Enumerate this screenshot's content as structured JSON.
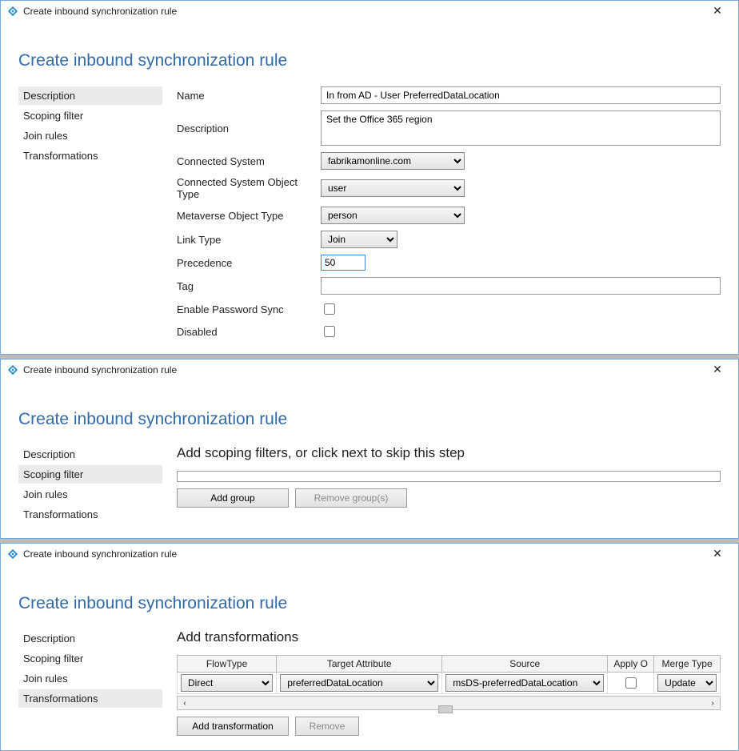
{
  "common": {
    "window_title": "Create inbound synchronization rule",
    "page_heading": "Create inbound synchronization rule",
    "close_glyph": "✕",
    "nav": {
      "description": "Description",
      "scoping": "Scoping filter",
      "join": "Join rules",
      "trans": "Transformations"
    }
  },
  "p1": {
    "labels": {
      "name": "Name",
      "description": "Description",
      "connected_system": "Connected System",
      "connected_obj_type": "Connected System Object Type",
      "mv_obj_type": "Metaverse Object Type",
      "link_type": "Link Type",
      "precedence": "Precedence",
      "tag": "Tag",
      "enable_pwd": "Enable Password Sync",
      "disabled": "Disabled"
    },
    "values": {
      "name": "In from AD - User PreferredDataLocation",
      "description": "Set the Office 365 region",
      "connected_system": "fabrikamonline.com",
      "connected_obj_type": "user",
      "mv_obj_type": "person",
      "link_type": "Join",
      "precedence": "50",
      "tag": ""
    }
  },
  "p2": {
    "heading": "Add scoping filters, or click next to skip this step",
    "add_group": "Add group",
    "remove_group": "Remove group(s)"
  },
  "p3": {
    "heading": "Add transformations",
    "cols": {
      "flowtype": "FlowType",
      "target": "Target Attribute",
      "source": "Source",
      "applyonce": "Apply Once",
      "applyonce_short": "Apply O",
      "merge": "Merge Type"
    },
    "row": {
      "flowtype": "Direct",
      "target": "preferredDataLocation",
      "source": "msDS-preferredDataLocation",
      "merge": "Update"
    },
    "scroll_left": "‹",
    "scroll_right": "›",
    "add_btn": "Add transformation",
    "remove_btn": "Remove"
  }
}
